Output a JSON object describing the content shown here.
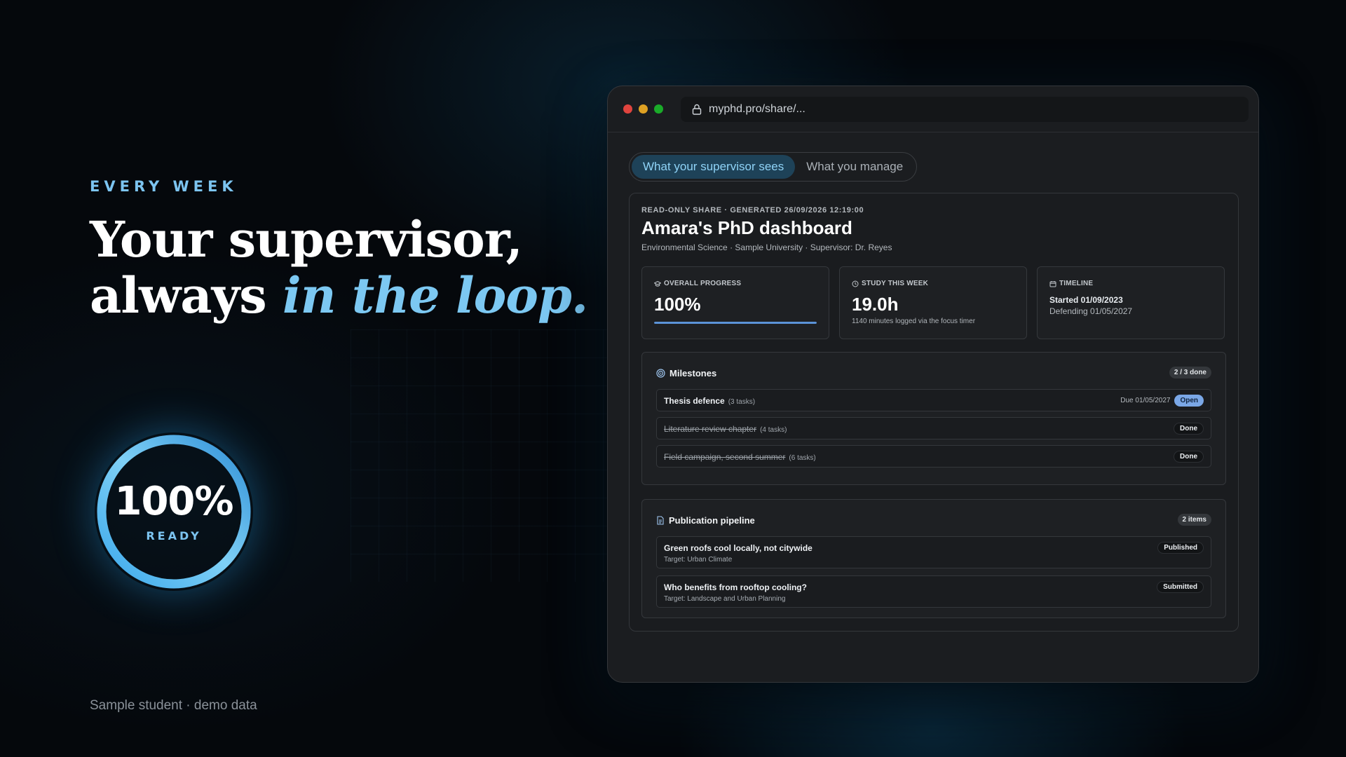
{
  "hero": {
    "eyebrow": "EVERY WEEK",
    "headline_line1": "Your supervisor,",
    "headline_line2_plain": "always ",
    "headline_line2_accent": "in the loop.",
    "ring_value": "100%",
    "ring_label": "READY",
    "ring_progress": 1.0,
    "footnote": "Sample student · demo data"
  },
  "browser": {
    "url": "myphd.pro/share/...",
    "tabs": [
      {
        "label": "What your supervisor sees",
        "active": true
      },
      {
        "label": "What you manage",
        "active": false
      }
    ]
  },
  "dashboard": {
    "meta": "READ-ONLY SHARE · GENERATED 26/09/2026 12:19:00",
    "title": "Amara's PhD dashboard",
    "subtitle": "Environmental Science · Sample University · Supervisor: Dr. Reyes",
    "cards": {
      "progress": {
        "label": "OVERALL PROGRESS",
        "value": "100%",
        "fraction": 1.0
      },
      "study": {
        "label": "STUDY THIS WEEK",
        "value": "19.0h",
        "note": "1140 minutes logged via the focus timer"
      },
      "timeline": {
        "label": "TIMELINE",
        "started": "Started 01/09/2023",
        "defending": "Defending 01/05/2027"
      }
    },
    "milestones": {
      "title": "Milestones",
      "badge": "2 / 3 done",
      "items": [
        {
          "title": "Thesis defence",
          "tasks": "(3 tasks)",
          "due": "Due 01/05/2027",
          "status": "Open"
        },
        {
          "title": "Literature review chapter",
          "tasks": "(4 tasks)",
          "status": "Done"
        },
        {
          "title": "Field campaign, second summer",
          "tasks": "(6 tasks)",
          "status": "Done"
        }
      ]
    },
    "publications": {
      "title": "Publication pipeline",
      "badge": "2 items",
      "items": [
        {
          "title": "Green roofs cool locally, not citywide",
          "target": "Target: Urban Climate",
          "status": "Published"
        },
        {
          "title": "Who benefits from rooftop cooling?",
          "target": "Target: Landscape and Urban Planning",
          "status": "Submitted"
        }
      ]
    }
  },
  "colors": {
    "accent": "#7cc8f2",
    "open_pill": "#7aa7e6",
    "progress_bar": "#5b93d8"
  }
}
